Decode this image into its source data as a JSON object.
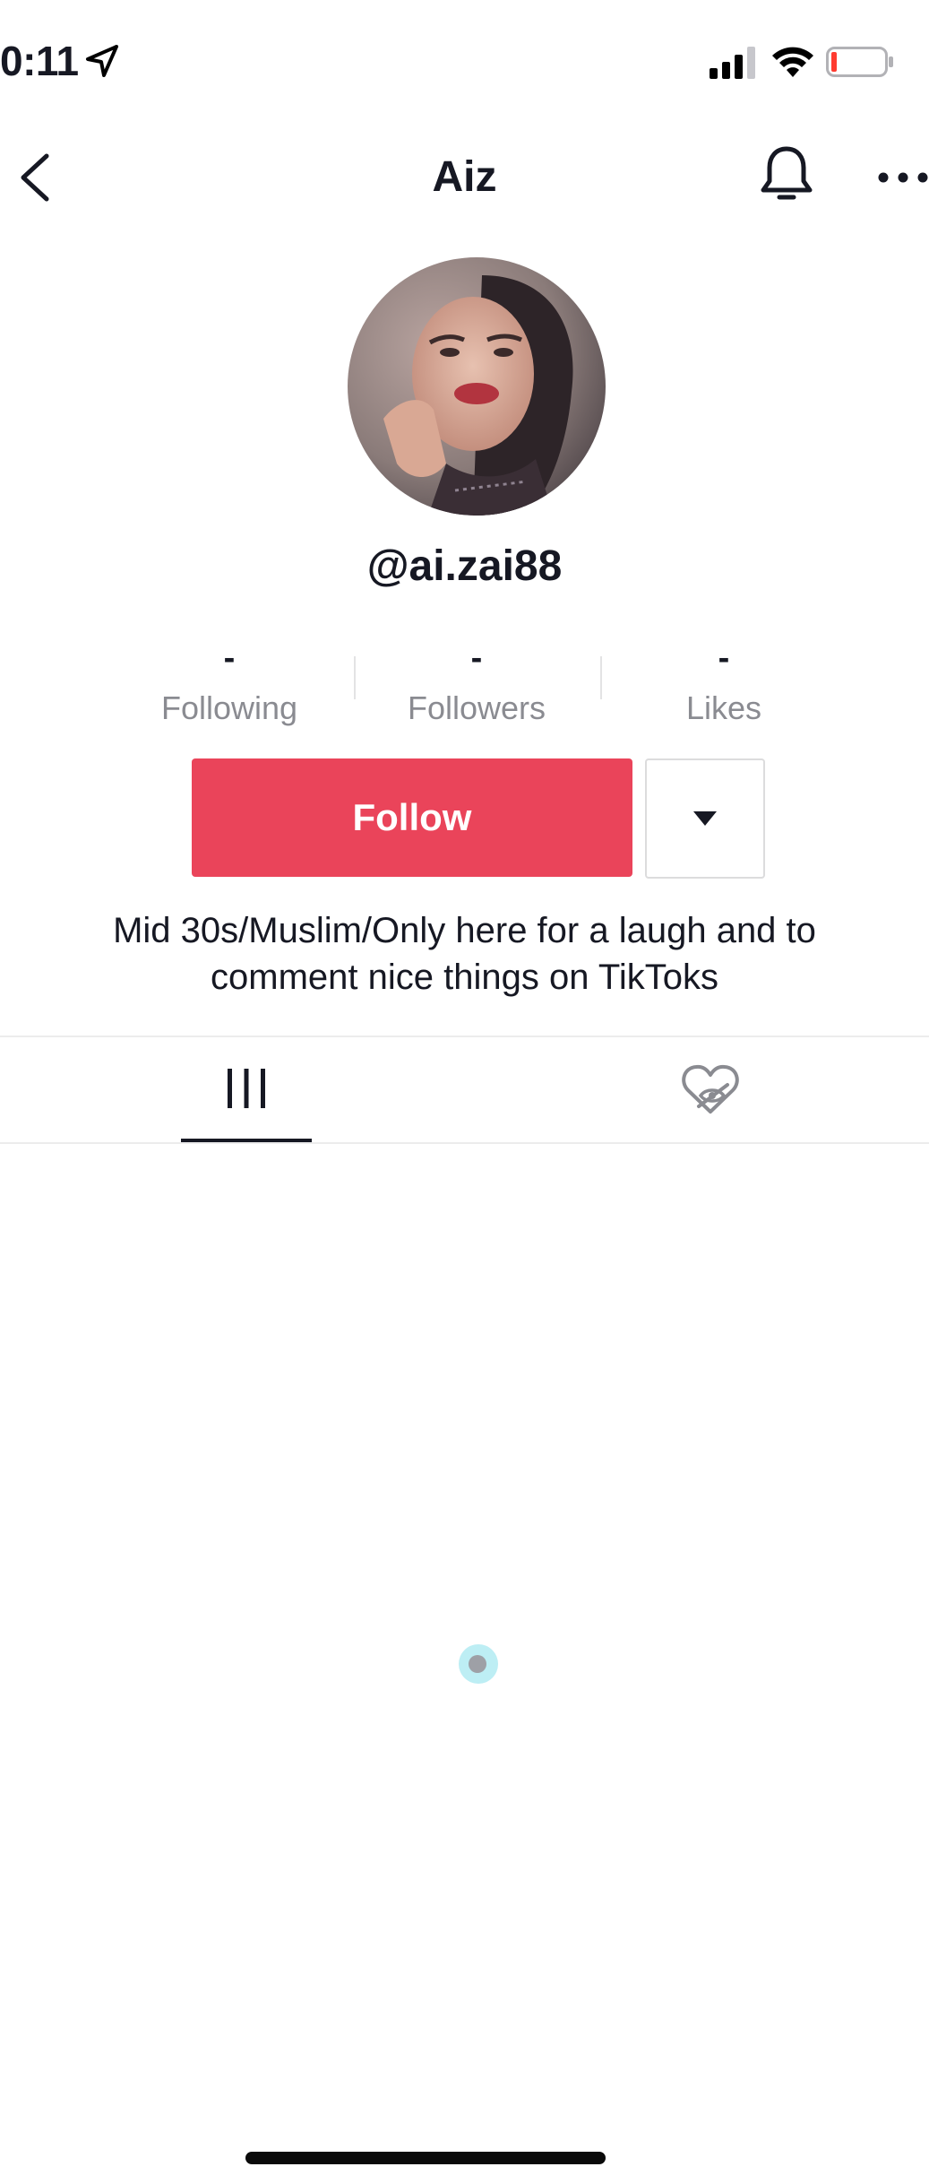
{
  "status_bar": {
    "time": "0:11",
    "icons": [
      "location-arrow-icon",
      "cellular-signal-icon",
      "wifi-icon",
      "battery-low-icon"
    ]
  },
  "nav": {
    "title": "Aiz",
    "back_icon": "chevron-left-icon",
    "bell_icon": "bell-icon",
    "more_icon": "more-horizontal-icon"
  },
  "profile": {
    "handle": "@ai.zai88",
    "stats": [
      {
        "value": "-",
        "label": "Following"
      },
      {
        "value": "-",
        "label": "Followers"
      },
      {
        "value": "-",
        "label": "Likes"
      }
    ],
    "follow_label": "Follow",
    "bio": "Mid 30s/Muslim/Only here for a laugh and to comment nice things on TikToks"
  },
  "tabs": {
    "items": [
      {
        "icon": "videos-grid-icon",
        "active": true
      },
      {
        "icon": "liked-hidden-heart-icon",
        "active": false
      }
    ]
  },
  "colors": {
    "accent": "#ea445a",
    "text": "#161823",
    "muted": "#8a8b91",
    "loader": "#bdeef4"
  }
}
